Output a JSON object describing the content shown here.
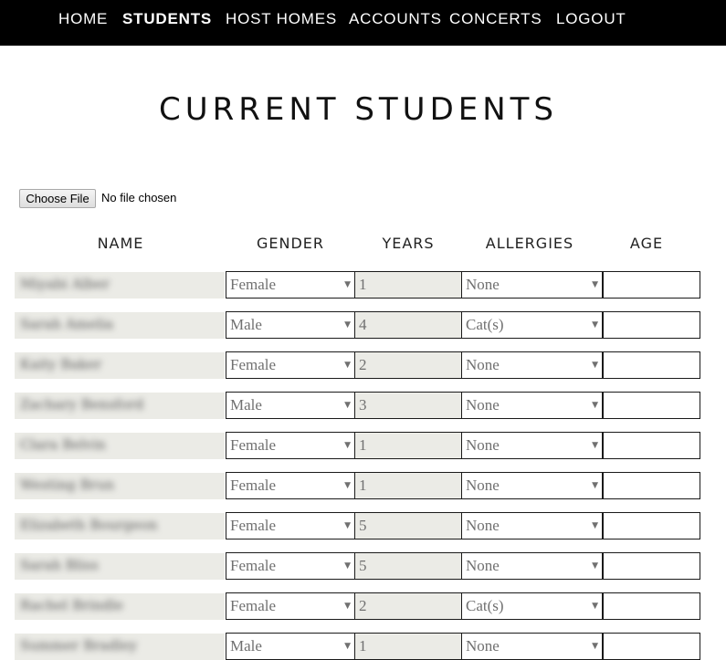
{
  "nav": {
    "items": [
      {
        "label": "HOME",
        "active": false
      },
      {
        "label": "STUDENTS",
        "active": true
      },
      {
        "label": "HOST HOMES",
        "active": false
      },
      {
        "label": "ACCOUNTS",
        "active": false
      },
      {
        "label": "CONCERTS",
        "active": false
      },
      {
        "label": "LOGOUT",
        "active": false
      }
    ]
  },
  "page": {
    "title": "CURRENT STUDENTS"
  },
  "upload": {
    "button_label": "Choose File",
    "status": "No file chosen"
  },
  "table": {
    "headers": [
      "NAME",
      "GENDER",
      "YEARS",
      "ALLERGIES",
      "AGE"
    ],
    "rows": [
      {
        "name": "Miyabi Alber",
        "gender": "Female",
        "years": "1",
        "allergies": "None",
        "age": ""
      },
      {
        "name": "Sarah Amelia",
        "gender": "Male",
        "years": "4",
        "allergies": "Cat(s)",
        "age": ""
      },
      {
        "name": "Kaity Baker",
        "gender": "Female",
        "years": "2",
        "allergies": "None",
        "age": ""
      },
      {
        "name": "Zachary Bensford",
        "gender": "Male",
        "years": "3",
        "allergies": "None",
        "age": ""
      },
      {
        "name": "Clara Belvin",
        "gender": "Female",
        "years": "1",
        "allergies": "None",
        "age": ""
      },
      {
        "name": "Westing Brun",
        "gender": "Female",
        "years": "1",
        "allergies": "None",
        "age": ""
      },
      {
        "name": "Elizabeth Bourgeon",
        "gender": "Female",
        "years": "5",
        "allergies": "None",
        "age": ""
      },
      {
        "name": "Sarah Bliss",
        "gender": "Female",
        "years": "5",
        "allergies": "None",
        "age": ""
      },
      {
        "name": "Rachel Brindle",
        "gender": "Female",
        "years": "2",
        "allergies": "Cat(s)",
        "age": ""
      },
      {
        "name": "Summer Bradley",
        "gender": "Male",
        "years": "1",
        "allergies": "None",
        "age": ""
      }
    ]
  },
  "icons": {
    "dropdown": "dropdown-caret-icon"
  },
  "colors": {
    "nav_bg": "#000000",
    "readonly_bg": "#ebebe6",
    "border": "#1a1a1a"
  }
}
